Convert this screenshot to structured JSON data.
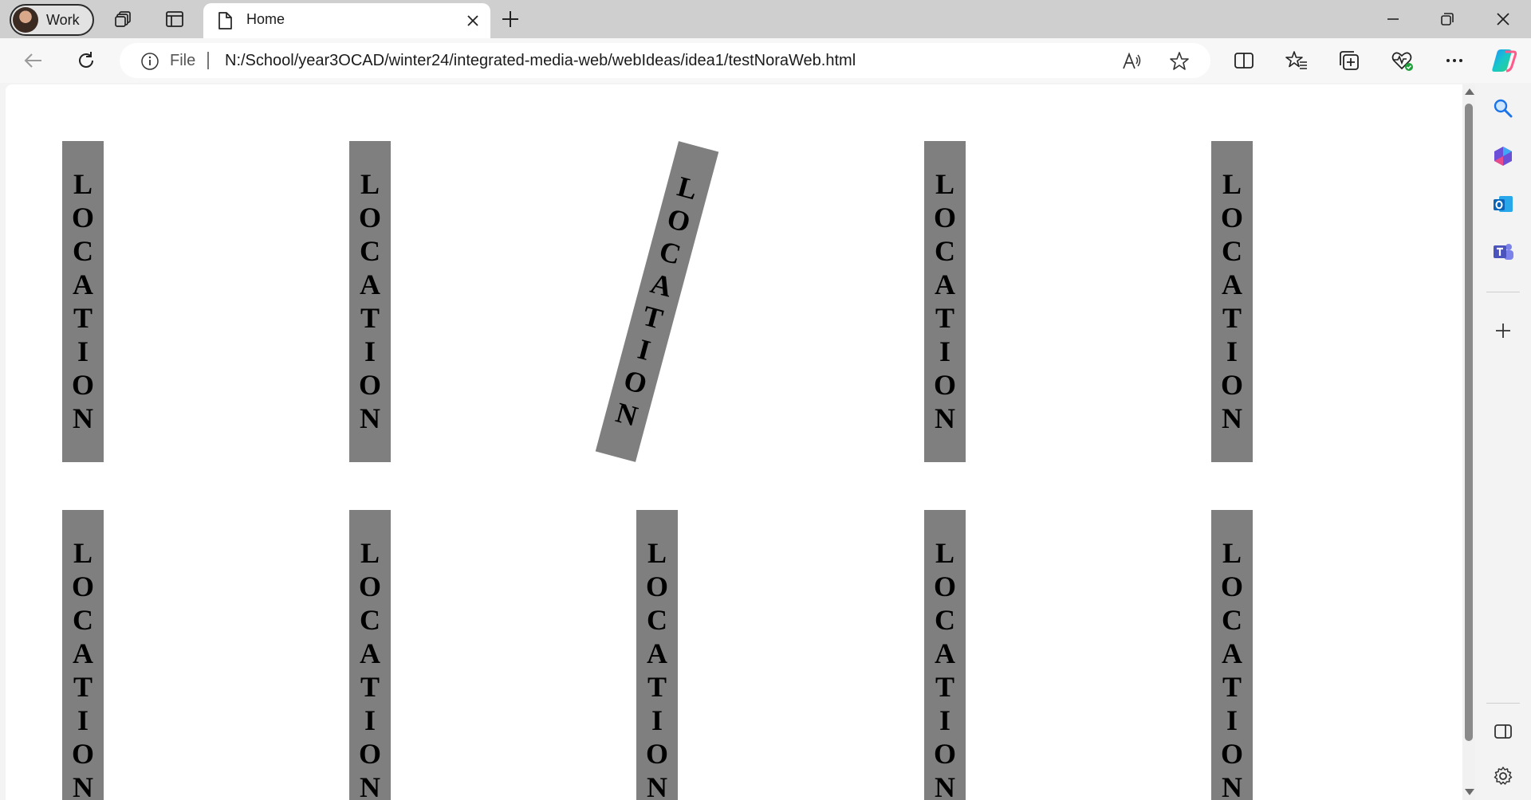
{
  "profile": {
    "label": "Work"
  },
  "tab": {
    "title": "Home"
  },
  "address": {
    "scheme_label": "File",
    "url": "N:/School/year3OCAD/winter24/integrated-media-web/webIdeas/idea1/testNoraWeb.html"
  },
  "page": {
    "strip_letters": [
      "L",
      "O",
      "C",
      "A",
      "T",
      "I",
      "O",
      "N"
    ],
    "strip_text": "LOCATION",
    "strip_color": "#7f7f7f",
    "tilted_strip_rotation_deg": 15
  },
  "icons": {
    "workspaces": "workspaces-icon",
    "vertical_tabs": "vertical-tabs-icon",
    "page": "page-icon",
    "close": "close-icon",
    "new_tab": "plus-icon",
    "back": "back-arrow-icon",
    "refresh": "refresh-icon",
    "info": "info-icon",
    "read_aloud": "read-aloud-icon",
    "favorite": "star-icon",
    "split_screen": "split-screen-icon",
    "favorites": "favorites-icon",
    "collections": "collections-icon",
    "performance": "heartbeat-icon",
    "more": "more-icon",
    "copilot": "copilot-icon",
    "search": "search-icon",
    "m365": "m365-icon",
    "outlook": "outlook-icon",
    "teams": "teams-icon",
    "add": "plus-icon",
    "sidebar_toggle": "sidebar-toggle-icon",
    "settings": "gear-icon"
  }
}
